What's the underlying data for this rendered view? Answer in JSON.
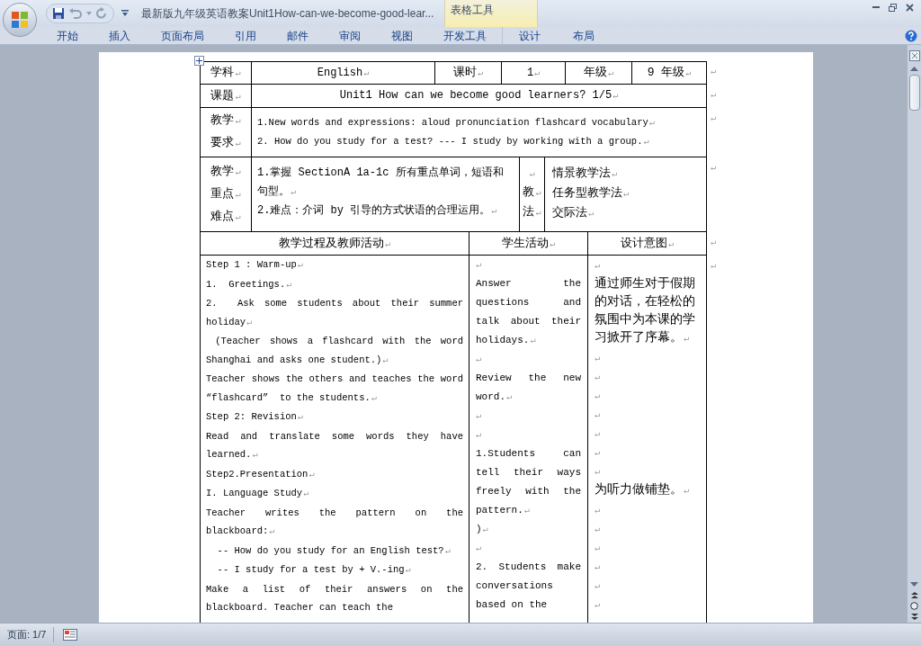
{
  "window": {
    "title": "最新版九年级英语教案Unit1How-can-we-become-good-lear...",
    "context_group": "表格工具"
  },
  "ribbon_tabs": [
    {
      "label": "开始",
      "kind": "main"
    },
    {
      "label": "插入",
      "kind": "main"
    },
    {
      "label": "页面布局",
      "kind": "main"
    },
    {
      "label": "引用",
      "kind": "main"
    },
    {
      "label": "邮件",
      "kind": "main"
    },
    {
      "label": "审阅",
      "kind": "main"
    },
    {
      "label": "视图",
      "kind": "main"
    },
    {
      "label": "开发工具",
      "kind": "main"
    },
    {
      "label": "设计",
      "kind": "context"
    },
    {
      "label": "布局",
      "kind": "context"
    }
  ],
  "table": {
    "info_row": {
      "end_mark": "↵",
      "cells": [
        {
          "text": "学科",
          "mark": "↵"
        },
        {
          "text": "English",
          "mark": "↵"
        },
        {
          "text": "课时",
          "mark": "↵"
        },
        {
          "text": "1",
          "mark": "↵"
        },
        {
          "text": "年级",
          "mark": "↵"
        },
        {
          "text": "9 年级",
          "mark": "↵"
        }
      ]
    },
    "topic_row": {
      "end_mark": "↵",
      "label": {
        "text": "课题",
        "mark": "↵"
      },
      "value": {
        "text": "Unit1 How can we become good learners? 1/5",
        "mark": "↵"
      }
    },
    "requirements_row": {
      "end_mark": "↵",
      "label": [
        {
          "text": "教学",
          "mark": "↵"
        },
        {
          "text": "要求",
          "mark": "↵"
        }
      ],
      "content": [
        {
          "text": "1.New words and expressions: aloud  pronunciation  flashcard  vocabulary",
          "mark": "↵"
        },
        {
          "text": " 2. How do you study for a test? --- I study by working with a group.",
          "mark": "↵"
        }
      ]
    },
    "focus_row": {
      "end_mark": "↵",
      "label": [
        {
          "text": "教学",
          "mark": "↵"
        },
        {
          "text": "重点",
          "mark": "↵"
        },
        {
          "text": "难点",
          "mark": "↵"
        }
      ],
      "content": [
        {
          "text": "1.掌握 SectionA 1a-1c 所有重点单词，短语和句型。",
          "mark": "↵"
        },
        {
          "text": "2.难点：介词 by 引导的方式状语的合理运用。",
          "mark": "↵"
        }
      ],
      "method_label": [
        {
          "mark": "↵"
        },
        {
          "text": "教",
          "mark": "↵"
        },
        {
          "text": "法",
          "mark": "↵"
        }
      ],
      "methods": [
        {
          "text": "情景教学法",
          "mark": "↵"
        },
        {
          "text": "任务型教学法",
          "mark": "↵"
        },
        {
          "text": "交际法",
          "mark": "↵"
        }
      ]
    },
    "process_header": {
      "end_mark": "↵",
      "cells": [
        {
          "text": "教学过程及教师活动",
          "mark": "↵"
        },
        {
          "text": "学生活动",
          "mark": "↵"
        },
        {
          "text": "设计意图",
          "mark": "↵"
        }
      ]
    },
    "process_body": {
      "end_mark": "↵",
      "teacher": [
        {
          "text": "Step 1 : Warm-up",
          "mark": "↵"
        },
        {
          "text": "1.  Greetings.",
          "mark": "↵"
        },
        {
          "text": "2.  Ask some students about their summer holiday",
          "mark": "↵"
        },
        {
          "text": " (Teacher shows a flashcard with the word Shanghai and asks one student.)",
          "mark": "↵"
        },
        {
          "text": "Teacher shows the others and teaches the word “flashcard”  to the students.",
          "mark": "↵"
        },
        {
          "text": "Step 2: Revision",
          "mark": "↵"
        },
        {
          "text": "Read and translate some words they have learned.",
          "mark": "↵"
        },
        {
          "text": "Step2.Presentation",
          "mark": "↵"
        },
        {
          "text": "I. Language Study",
          "mark": "↵"
        },
        {
          "text": "Teacher writes the pattern on the blackboard:",
          "mark": "↵"
        },
        {
          "text": "  -- How do you study for an English test?",
          "mark": "↵"
        },
        {
          "text": "  -- I study for a test by + V.-ing",
          "mark": "↵"
        },
        {
          "text": "Make a list of their answers on the blackboard. Teacher can teach the"
        }
      ],
      "students": [
        {
          "mark": "↵"
        },
        {
          "text": "Answer the questions and talk about their holidays.",
          "mark": "↵"
        },
        {
          "mark": "↵"
        },
        {
          "text": "Review the new word.",
          "mark": "↵"
        },
        {
          "mark": "↵"
        },
        {
          "mark": "↵"
        },
        {
          "text": "1.Students can tell their ways freely with the pattern.",
          "mark": "↵"
        },
        {
          "text": ")",
          "mark": "↵"
        },
        {
          "mark": "↵"
        },
        {
          "text": "2. Students make conversations based on the"
        }
      ],
      "purpose": [
        {
          "mark": "↵"
        },
        {
          "text": "通过师生对于假期的对话，在轻松的氛围中为本课的学习掀开了序幕。",
          "mark": "↵"
        },
        {
          "mark": "↵"
        },
        {
          "mark": "↵"
        },
        {
          "mark": "↵"
        },
        {
          "mark": "↵"
        },
        {
          "mark": "↵"
        },
        {
          "mark": "↵"
        },
        {
          "mark": "↵"
        },
        {
          "text": "为听力做铺垫。",
          "mark": "↵"
        },
        {
          "mark": "↵"
        },
        {
          "mark": "↵"
        },
        {
          "mark": "↵"
        },
        {
          "mark": "↵"
        },
        {
          "mark": "↵"
        },
        {
          "mark": "↵"
        }
      ]
    }
  },
  "status_bar": {
    "page": "页面: 1/7"
  }
}
